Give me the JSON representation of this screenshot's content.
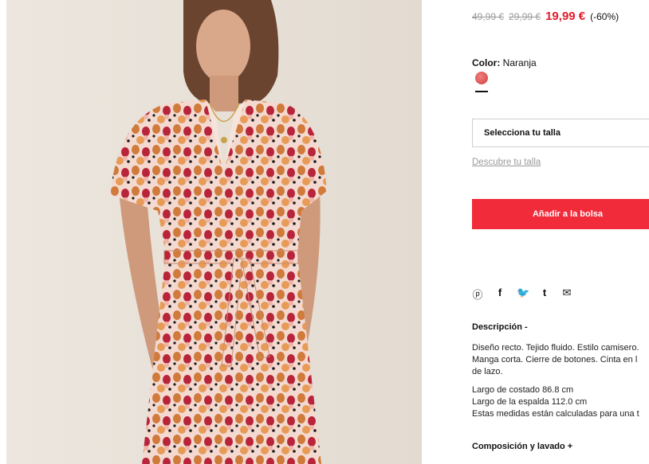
{
  "product_image": {
    "alt_icon": "model-photo"
  },
  "price": {
    "original": "49,99 €",
    "previous": "29,99 €",
    "current": "19,99 €",
    "discount": "(-60%)",
    "current_color": "#e31b2c"
  },
  "color": {
    "label": "Color:",
    "value": "Naranja",
    "swatch_color": "#e05a55"
  },
  "size": {
    "select_label": "Selecciona tu talla",
    "guide_link": "Descubre tu talla"
  },
  "cart": {
    "add_button": "Añadir a la bolsa",
    "button_color": "#f12b3a"
  },
  "share_icons": [
    "pinterest-icon",
    "facebook-icon",
    "twitter-icon",
    "tumblr-icon",
    "email-icon"
  ],
  "description": {
    "title": "Descripción -",
    "line1": "Diseño recto. Tejido fluido. Estilo camisero.",
    "line2": "Manga corta. Cierre de botones. Cinta en l",
    "line3": "de lazo.",
    "measure1": "Largo de costado 86.8 cm",
    "measure2": "Largo de la espalda 112.0 cm",
    "measure3": "Estas medidas están calculadas para una t"
  },
  "composition": {
    "title": "Composición y lavado +"
  }
}
